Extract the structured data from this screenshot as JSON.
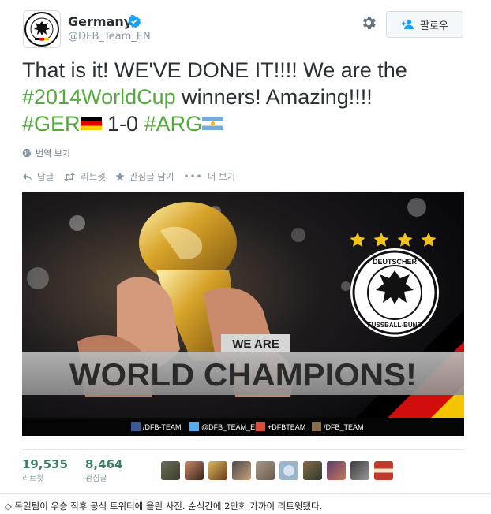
{
  "profile": {
    "name": "Germany",
    "handle": "@DFB_Team_EN",
    "follow_label": "팔로우"
  },
  "tweet": {
    "line1": "That is it! WE'VE DONE IT!!!! We are the",
    "hashtag_wc": "#2014WorldCup",
    "line2_rest": " winners! Amazing!!!!",
    "hashtag_ger": "#GER",
    "score": " 1-0 ",
    "hashtag_arg": "#ARG"
  },
  "translate_label": "번역 보기",
  "actions": {
    "reply": "답글",
    "retweet": "리트윗",
    "favorite": "관심글 담기",
    "more": "더 보기"
  },
  "photo": {
    "we_are": "WE ARE",
    "headline": "WORLD CHAMPIONS!",
    "crest_top": "DEUTSCHER",
    "crest_bottom": "FUSSBALL-BUND",
    "social": [
      {
        "icon": "facebook-icon",
        "text": "/DFB-TEAM"
      },
      {
        "icon": "twitter-icon",
        "text": "@DFB_TEAM_EN"
      },
      {
        "icon": "googleplus-icon",
        "text": "+DFBTEAM"
      },
      {
        "icon": "instagram-icon",
        "text": "/DFB_TEAM"
      }
    ]
  },
  "stats": {
    "retweets": "19,535",
    "retweets_label": "리트윗",
    "favorites": "8,464",
    "favorites_label": "관심글"
  },
  "caption": "◇ 독일팀이 우승 직후 공식 트위터에 올린 사진. 순식간에 2만회 가까이 리트윗됐다.",
  "colors": {
    "hashtag": "#55ac3e",
    "stat_number": "#3a7d68",
    "verified": "#1da1f2"
  }
}
